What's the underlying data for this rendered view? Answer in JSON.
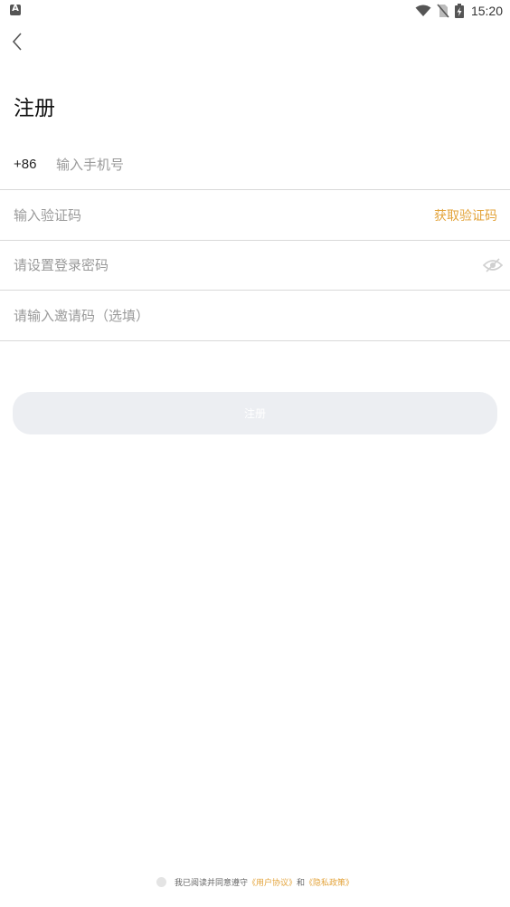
{
  "status_bar": {
    "time": "15:20",
    "notification_glyph": "A"
  },
  "header": {
    "title": "注册"
  },
  "form": {
    "country_code": "+86",
    "phone_placeholder": "输入手机号",
    "code_placeholder": "输入验证码",
    "get_code_label": "获取验证码",
    "password_placeholder": "请设置登录密码",
    "invite_placeholder": "请输入邀请码（选填）"
  },
  "submit": {
    "label": "注册"
  },
  "agreement": {
    "prefix": "我已阅读并同意遵守",
    "user_agreement": "《用户协议》",
    "connector": "和",
    "privacy_policy": "《隐私政策》"
  },
  "colors": {
    "accent": "#e3a33a",
    "button_bg": "#eceef2",
    "divider": "#d9d9d9",
    "placeholder": "#9a9a9a"
  }
}
